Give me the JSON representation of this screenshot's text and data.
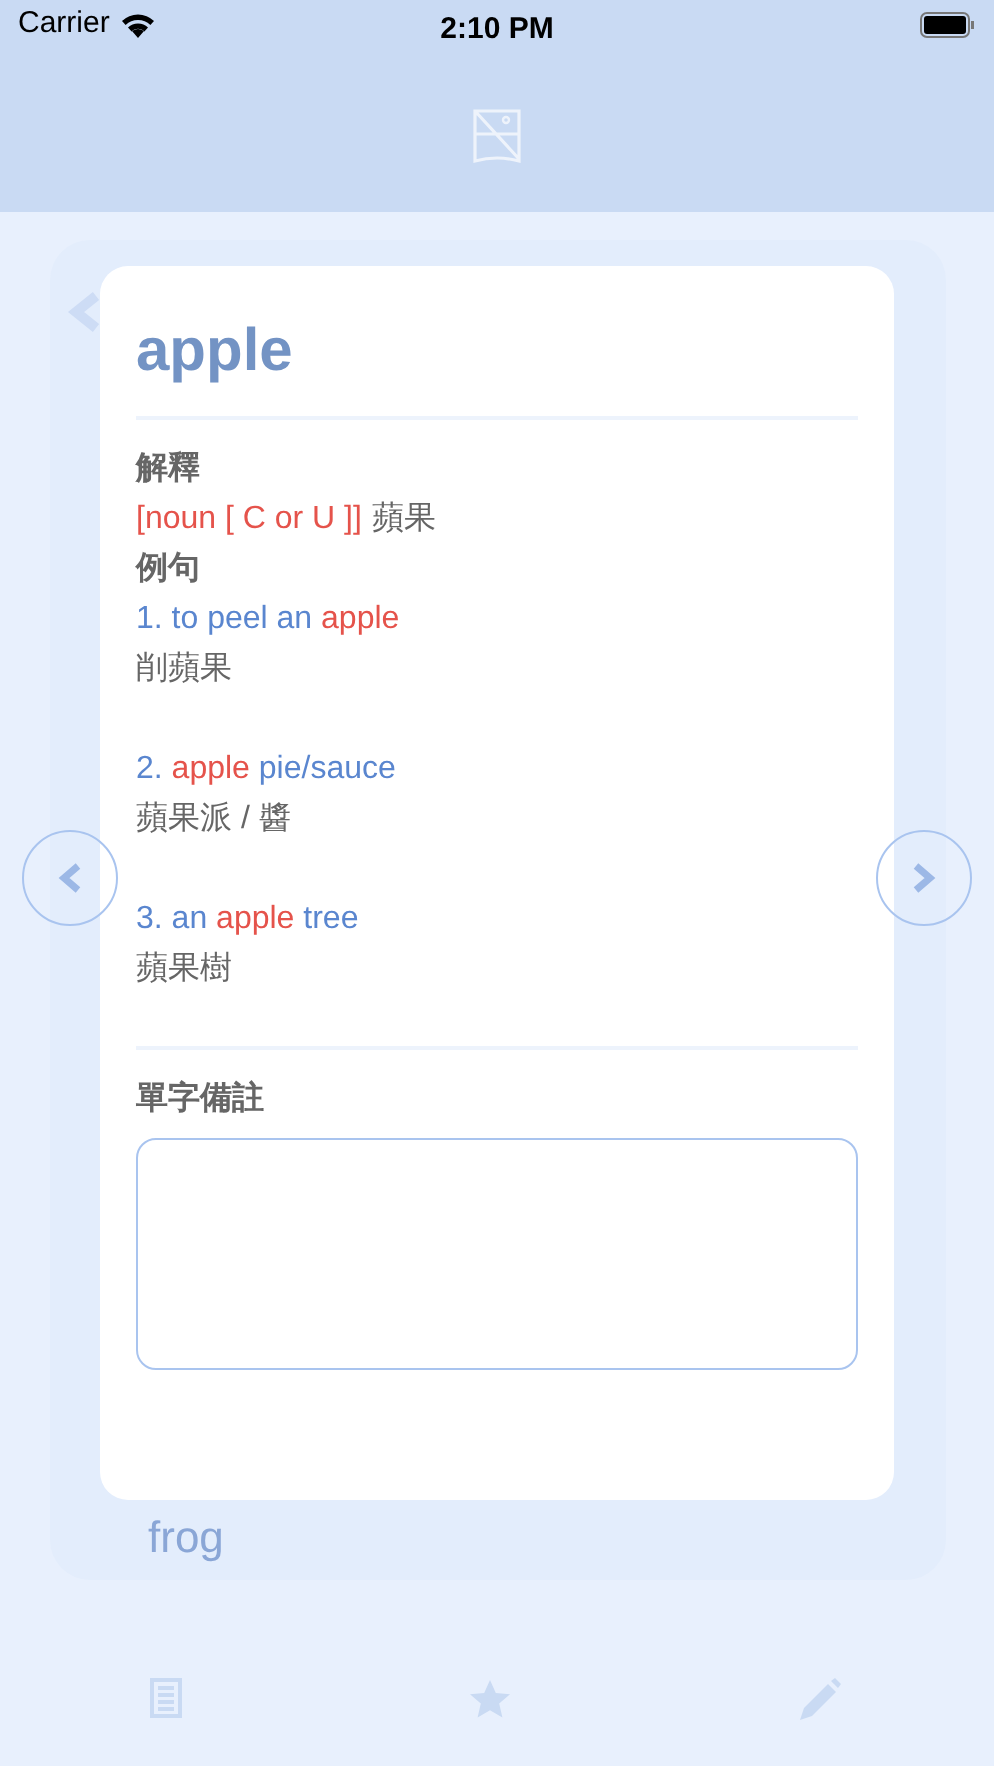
{
  "status_bar": {
    "carrier": "Carrier",
    "time": "2:10 PM"
  },
  "background_card": {
    "word": "frog"
  },
  "card": {
    "word": "apple",
    "definition_label": "解釋",
    "definition": {
      "tag": "[noun [ C or U ]]",
      "text": "蘋果"
    },
    "examples_label": "例句",
    "examples": [
      {
        "number": "1.",
        "parts": [
          {
            "text": "to peel an",
            "highlight": false
          },
          {
            "text": "apple",
            "highlight": true
          }
        ],
        "translation": "削蘋果"
      },
      {
        "number": "2.",
        "parts": [
          {
            "text": "apple",
            "highlight": true
          },
          {
            "text": "pie/sauce",
            "highlight": false
          }
        ],
        "translation": "蘋果派 / 醬"
      },
      {
        "number": "3.",
        "parts": [
          {
            "text": "an",
            "highlight": false
          },
          {
            "text": "apple",
            "highlight": true
          },
          {
            "text": "tree",
            "highlight": false
          }
        ],
        "translation": "蘋果樹"
      }
    ],
    "note_label": "單字備註"
  }
}
